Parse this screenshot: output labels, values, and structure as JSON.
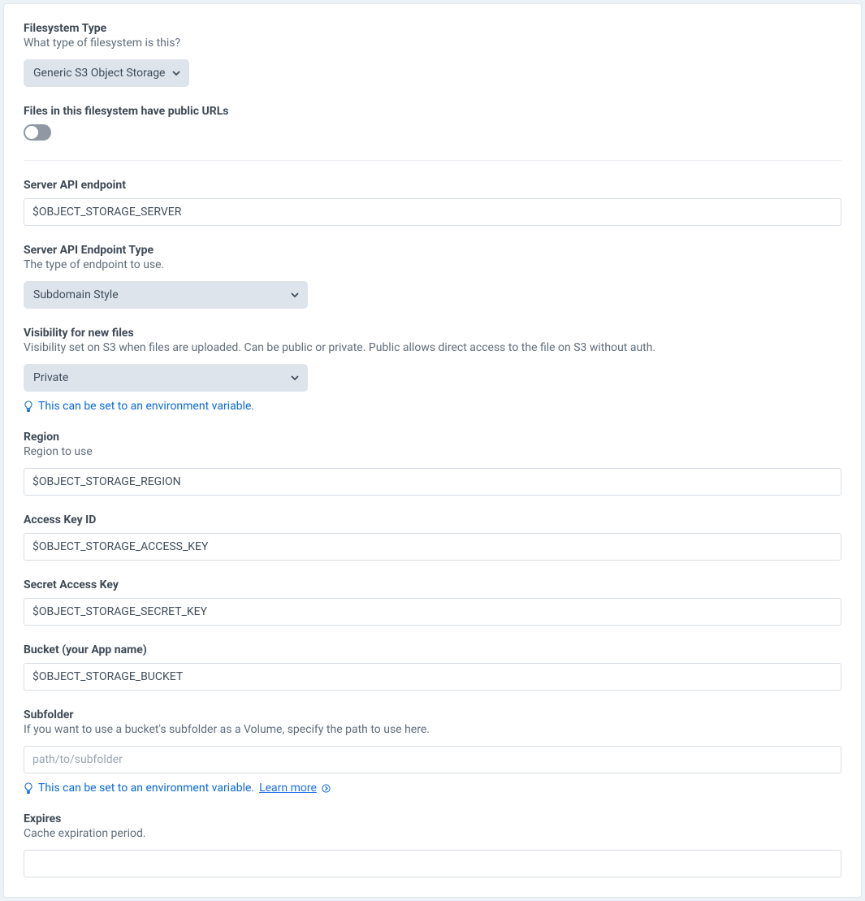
{
  "fields": {
    "filesystem_type": {
      "label": "Filesystem Type",
      "desc": "What type of filesystem is this?",
      "value": "Generic S3 Object Storage"
    },
    "public_urls": {
      "label": "Files in this filesystem have public URLs",
      "value": false
    },
    "server_api_endpoint": {
      "label": "Server API endpoint",
      "value": "$OBJECT_STORAGE_SERVER"
    },
    "endpoint_type": {
      "label": "Server API Endpoint Type",
      "desc": "The type of endpoint to use.",
      "value": "Subdomain Style"
    },
    "visibility": {
      "label": "Visibility for new files",
      "desc": "Visibility set on S3 when files are uploaded. Can be public or private. Public allows direct access to the file on S3 without auth.",
      "value": "Private",
      "tip": "This can be set to an environment variable."
    },
    "region": {
      "label": "Region",
      "desc": "Region to use",
      "value": "$OBJECT_STORAGE_REGION"
    },
    "access_key": {
      "label": "Access Key ID",
      "value": "$OBJECT_STORAGE_ACCESS_KEY"
    },
    "secret_key": {
      "label": "Secret Access Key",
      "value": "$OBJECT_STORAGE_SECRET_KEY"
    },
    "bucket": {
      "label": "Bucket (your App name)",
      "value": "$OBJECT_STORAGE_BUCKET"
    },
    "subfolder": {
      "label": "Subfolder",
      "desc": "If you want to use a bucket's subfolder as a Volume, specify the path to use here.",
      "placeholder": "path/to/subfolder",
      "tip": "This can be set to an environment variable.",
      "learn_more": "Learn more"
    },
    "expires": {
      "label": "Expires",
      "desc": "Cache expiration period."
    }
  }
}
